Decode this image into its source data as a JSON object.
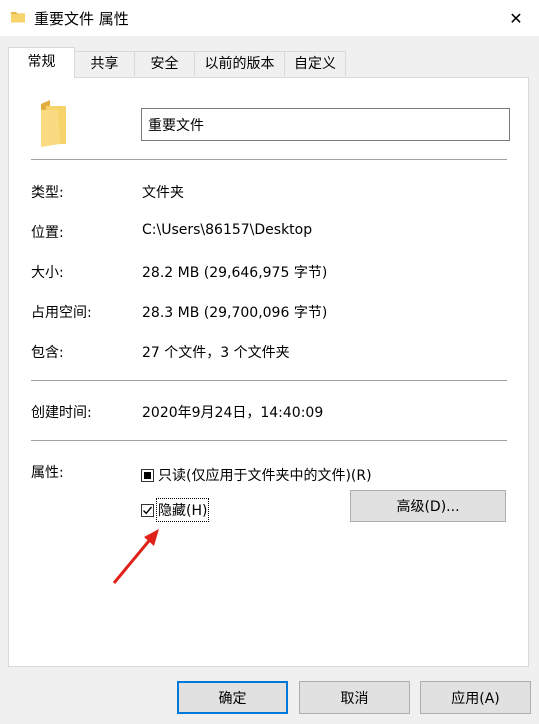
{
  "window": {
    "title": "重要文件 属性",
    "close_glyph": "✕"
  },
  "tabs": [
    {
      "label": "常规",
      "active": true
    },
    {
      "label": "共享",
      "active": false
    },
    {
      "label": "安全",
      "active": false
    },
    {
      "label": "以前的版本",
      "active": false
    },
    {
      "label": "自定义",
      "active": false
    }
  ],
  "general": {
    "name_value": "重要文件",
    "type_label": "类型:",
    "type_value": "文件夹",
    "location_label": "位置:",
    "location_value": "C:\\Users\\86157\\Desktop",
    "size_label": "大小:",
    "size_value": "28.2 MB (29,646,975 字节)",
    "size_on_disk_label": "占用空间:",
    "size_on_disk_value": "28.3 MB (29,700,096 字节)",
    "contains_label": "包含:",
    "contains_value": "27 个文件，3 个文件夹",
    "created_label": "创建时间:",
    "created_value": "2020年9月24日，14:40:09",
    "attributes_label": "属性:",
    "readonly_label": "只读(仅应用于文件夹中的文件)(R)",
    "readonly_state": "indeterminate",
    "hidden_label": "隐藏(H)",
    "hidden_state": "checked",
    "advanced_button": "高级(D)..."
  },
  "footer": {
    "ok": "确定",
    "cancel": "取消",
    "apply": "应用(A)"
  },
  "colors": {
    "accent": "#0078d7",
    "folder": "#f6d36b",
    "arrow": "#e0211a"
  }
}
